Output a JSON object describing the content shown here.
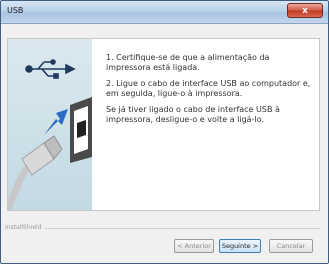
{
  "window": {
    "title": "USB",
    "close_glyph": "x"
  },
  "graphic": {
    "icons": [
      "usb-symbol-icon",
      "arrow-icon",
      "usb-port-icon",
      "usb-plug-icon"
    ],
    "accent": "#2b6cc4"
  },
  "instructions": [
    "1. Certifique-se de que a alimentação da impressora está ligada.",
    "2. Ligue o cabo de interface USB ao computador e, em seguida, ligue-o à impressora.",
    "Se já tiver ligado o cabo de interface USB à impressora, desligue-o e volte a ligá-lo."
  ],
  "footer": {
    "brand": "InstallShield"
  },
  "buttons": {
    "back": "< Anterior",
    "next": "Seguinte >",
    "cancel": "Cancelar"
  }
}
